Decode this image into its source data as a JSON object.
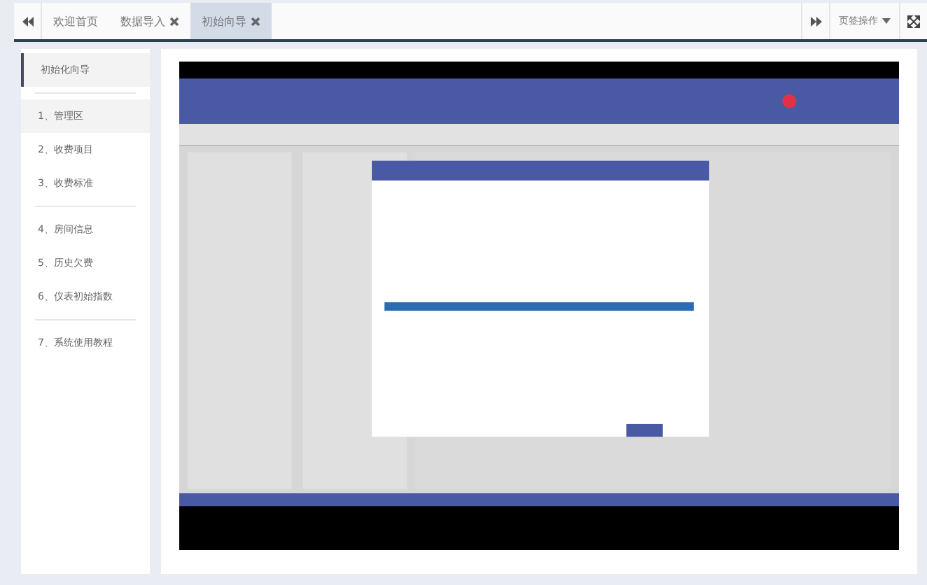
{
  "tabs": [
    {
      "label": "欢迎首页",
      "closable": false,
      "selected": false
    },
    {
      "label": "数据导入",
      "closable": true,
      "selected": false
    },
    {
      "label": "初始向导",
      "closable": true,
      "selected": true
    }
  ],
  "tab_actions": {
    "label": "页签操作"
  },
  "sidebar": {
    "title": "初始化向导",
    "groups": [
      {
        "items": [
          {
            "label": "1、管理区",
            "selected": true
          },
          {
            "label": "2、收费项目",
            "selected": false
          },
          {
            "label": "3、收费标准",
            "selected": false
          }
        ]
      },
      {
        "items": [
          {
            "label": "4、房间信息",
            "selected": false
          },
          {
            "label": "5、历史欠费",
            "selected": false
          },
          {
            "label": "6、仪表初始指数",
            "selected": false
          }
        ]
      },
      {
        "items": [
          {
            "label": "7、系统使用教程",
            "selected": false
          }
        ]
      }
    ]
  }
}
